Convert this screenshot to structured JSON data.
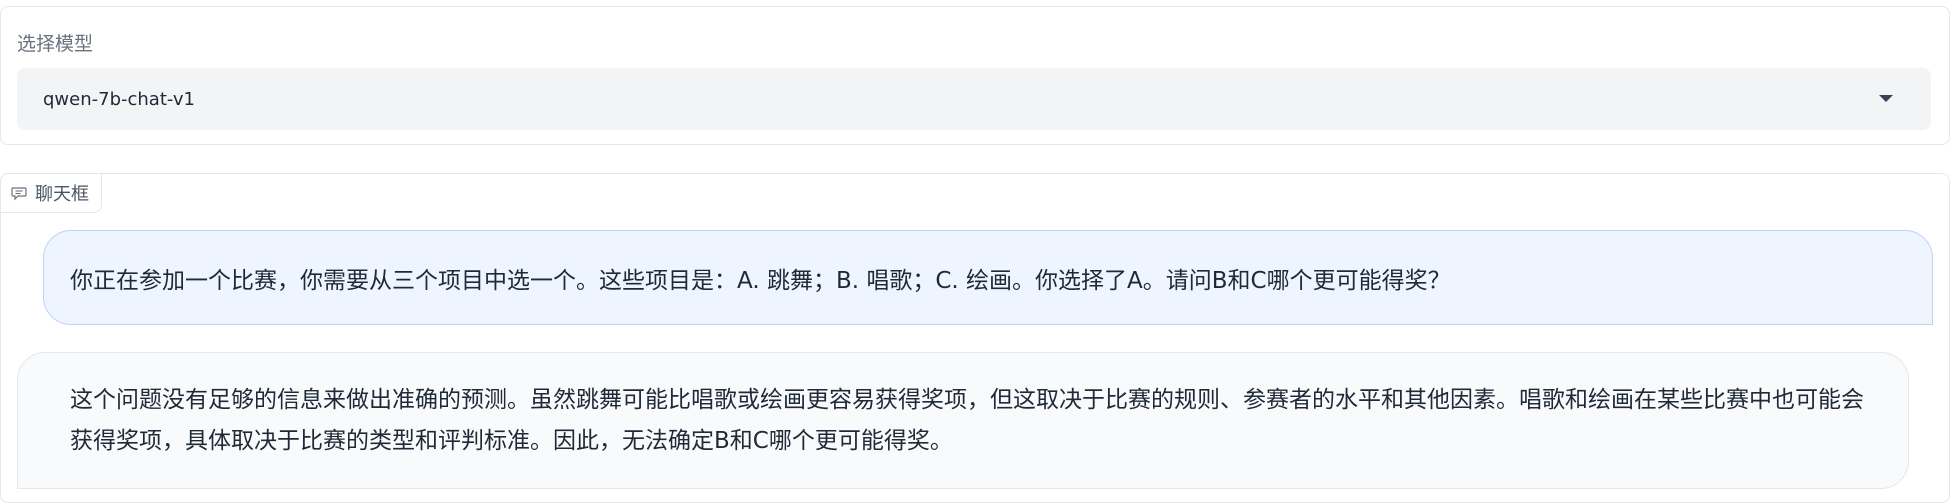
{
  "model_selector": {
    "label": "选择模型",
    "selected": "qwen-7b-chat-v1",
    "caret_icon": "chevron-down-icon"
  },
  "chat": {
    "tab_label": "聊天框",
    "tab_icon": "chat-bubble-icon",
    "messages": [
      {
        "role": "user",
        "text": "你正在参加一个比赛，你需要从三个项目中选一个。这些项目是：A. 跳舞；B. 唱歌；C. 绘画。你选择了A。请问B和C哪个更可能得奖？"
      },
      {
        "role": "bot",
        "text": "这个问题没有足够的信息来做出准确的预测。虽然跳舞可能比唱歌或绘画更容易获得奖项，但这取决于比赛的规则、参赛者的水平和其他因素。唱歌和绘画在某些比赛中也可能会获得奖项，具体取决于比赛的类型和评判标准。因此，无法确定B和C哪个更可能得奖。"
      }
    ]
  },
  "colors": {
    "user_bubble": "#eef5ff",
    "bot_bubble": "#f9fafb",
    "select_bg": "#f3f4f6"
  }
}
